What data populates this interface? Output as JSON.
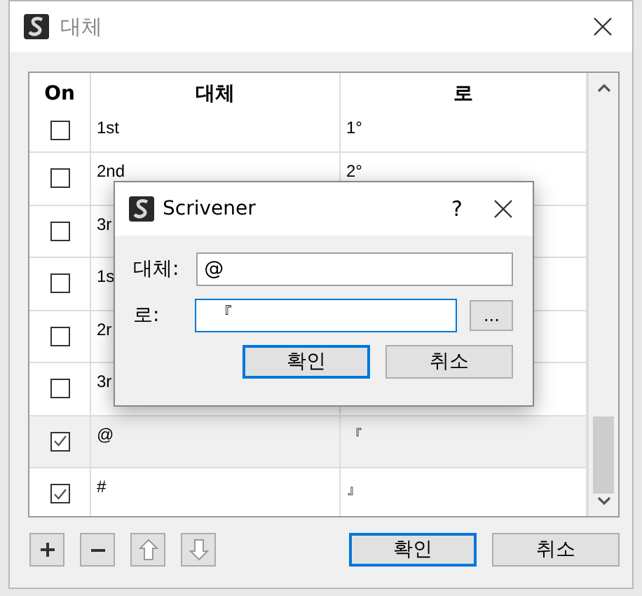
{
  "window": {
    "title": "대체"
  },
  "table": {
    "columns": [
      "On",
      "대체",
      "로"
    ],
    "rows": [
      {
        "checked": false,
        "selected": false,
        "from": "1st",
        "to": "1°"
      },
      {
        "checked": false,
        "selected": false,
        "from": "2nd",
        "to": "2°"
      },
      {
        "checked": false,
        "selected": false,
        "from": "3r"
      },
      {
        "checked": false,
        "selected": false,
        "from": "1s"
      },
      {
        "checked": false,
        "selected": false,
        "from": "2r"
      },
      {
        "checked": false,
        "selected": false,
        "from": "3r"
      },
      {
        "checked": true,
        "selected": true,
        "from": "@",
        "to": "『"
      },
      {
        "checked": true,
        "selected": false,
        "from": "#",
        "to": "』"
      }
    ]
  },
  "toolbar": {
    "ok": "확인",
    "cancel": "취소"
  },
  "dialog": {
    "title": "Scrivener",
    "help": "?",
    "fields": [
      {
        "label": "대체:",
        "value": "@",
        "focused": false
      },
      {
        "label": "로:",
        "value": "『",
        "focused": true,
        "browse": "..."
      }
    ],
    "ok": "확인",
    "cancel": "취소"
  }
}
